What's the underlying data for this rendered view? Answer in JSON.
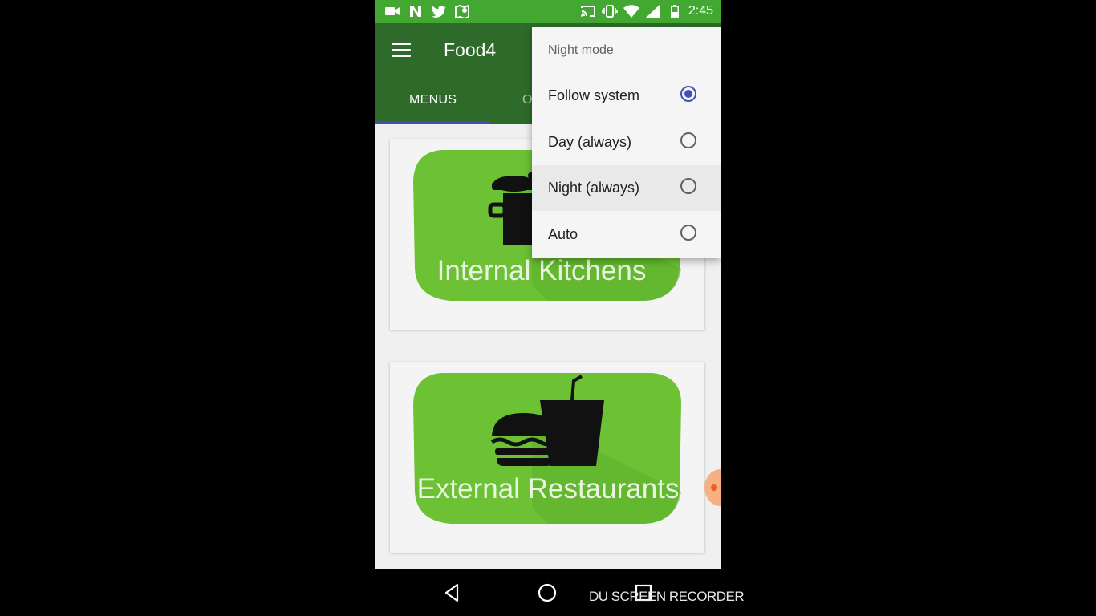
{
  "app": {
    "title": "Food4"
  },
  "status_bar": {
    "time": "2:45",
    "icons_left": [
      "video-icon",
      "n-icon",
      "twitter-icon",
      "map-icon"
    ],
    "icons_right": [
      "cast-icon",
      "vibrate-icon",
      "wifi-icon",
      "signal-icon",
      "battery-icon"
    ]
  },
  "tabs": [
    {
      "label": "MENUS",
      "active": true
    },
    {
      "label": "O",
      "active": false
    }
  ],
  "cards": [
    {
      "label": "Internal Kitchens",
      "icon": "cooking-pot-icon"
    },
    {
      "label": "External Restaurants",
      "icon": "burger-drink-icon"
    }
  ],
  "night_mode_menu": {
    "header": "Night mode",
    "options": [
      {
        "label": "Follow system",
        "selected": true
      },
      {
        "label": "Day (always)",
        "selected": false
      },
      {
        "label": "Night (always)",
        "selected": false
      },
      {
        "label": "Auto",
        "selected": false
      }
    ]
  },
  "watermark": "DU SCREEN RECORDER",
  "colors": {
    "status_bar": "#43a832",
    "app_bar": "#2e6b2a",
    "tab_indicator": "#3f51b5",
    "card_green": "#6cc234",
    "radio_selected": "#3f51b5"
  }
}
